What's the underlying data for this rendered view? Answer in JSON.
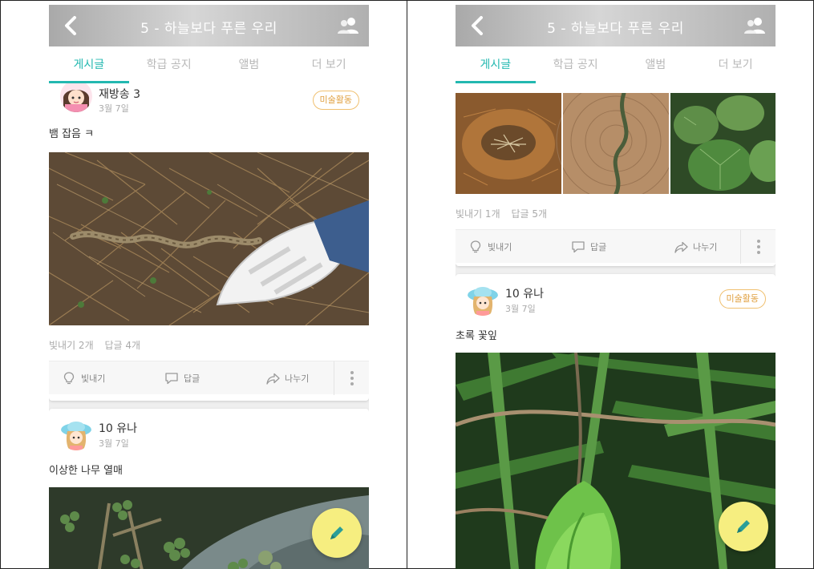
{
  "left": {
    "header": {
      "title": "5 - 하늘보다 푸른 우리"
    },
    "tabs": [
      {
        "label": "게시글",
        "active": true
      },
      {
        "label": "학급 공지",
        "active": false
      },
      {
        "label": "앨범",
        "active": false
      },
      {
        "label": "더 보기",
        "active": false
      }
    ],
    "posts": [
      {
        "author": "재방송 3",
        "date": "3월 7일",
        "tag": "미술활동",
        "text": "뱀 잡음 ㅋ",
        "likes_text": "빛내기 2개",
        "comments_text": "답글 4개"
      },
      {
        "author": "10 유나",
        "date": "3월 7일",
        "text": "이상한 나무 열매"
      }
    ],
    "actions": {
      "like": "빛내기",
      "comment": "답글",
      "share": "나누기"
    }
  },
  "right": {
    "header": {
      "title": "5 - 하늘보다 푸른 우리"
    },
    "tabs": [
      {
        "label": "게시글",
        "active": true
      },
      {
        "label": "학급 공지",
        "active": false
      },
      {
        "label": "앨범",
        "active": false
      },
      {
        "label": "더 보기",
        "active": false
      }
    ],
    "posts": [
      {
        "likes_text": "빛내기 1개",
        "comments_text": "답글 5개"
      },
      {
        "author": "10 유나",
        "date": "3월 7일",
        "tag": "미술활동",
        "text": "초록 꽃잎"
      }
    ],
    "actions": {
      "like": "빛내기",
      "comment": "답글",
      "share": "나누기"
    }
  },
  "colors": {
    "accent": "#23b8b0",
    "tag": "#e0a040",
    "fab": "#f6ee80"
  },
  "icons": [
    "back-arrow-icon",
    "members-icon",
    "lightbulb-icon",
    "comment-icon",
    "share-icon",
    "more-vertical-icon",
    "pencil-icon"
  ]
}
